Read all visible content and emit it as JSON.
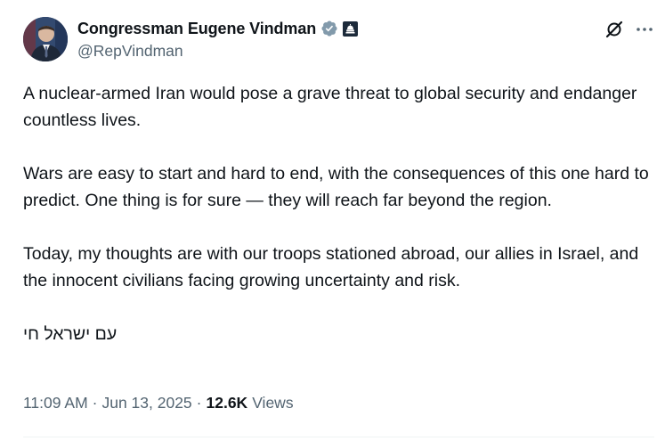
{
  "author": {
    "display_name": "Congressman Eugene Vindman",
    "handle": "@RepVindman",
    "verified_icon": "verified-badge-icon",
    "affiliation_icon": "capitol-dome-icon"
  },
  "header_actions": {
    "grok_icon": "grok-slash-icon",
    "more_icon": "more-horizontal-icon"
  },
  "tweet": {
    "paragraphs": [
      "A nuclear-armed Iran would pose a grave threat to global security and endanger countless lives.",
      "Wars are easy to start and hard to end, with the consequences of this one hard to predict. One thing is for sure — they will reach far beyond the region.",
      "Today, my thoughts are with our troops stationed abroad, our allies in Israel, and the innocent civilians facing growing uncertainty and risk.",
      "עם ישראל חי"
    ]
  },
  "meta": {
    "time": "11:09 AM",
    "separator": "·",
    "date": "Jun 13, 2025",
    "views_count": "12.6K",
    "views_label": "Views"
  },
  "colors": {
    "text_primary": "#0f1419",
    "text_secondary": "#536471",
    "verified_gray": "#829aab",
    "affiliation_bg": "#1c2a3a"
  }
}
